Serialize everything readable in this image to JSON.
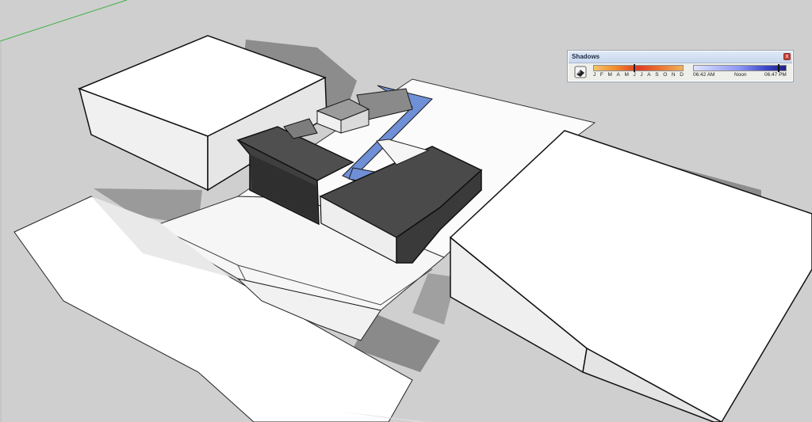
{
  "shadows_panel": {
    "title": "Shadows",
    "close_glyph": "x",
    "toggle_icon": "shadow-toggle-icon",
    "months": [
      "J",
      "F",
      "M",
      "A",
      "M",
      "J",
      "J",
      "A",
      "S",
      "O",
      "N",
      "D"
    ],
    "month_position": 0.45,
    "time_labels": {
      "sunrise": "06:42 AM",
      "noon": "Noon",
      "sunset": "06:47 PM"
    },
    "time_position": 0.93
  },
  "colors": {
    "background": "#cfcfcf",
    "white_face": "#ffffff",
    "light_side": "#ededed",
    "shadow": "#7a7a7a",
    "dark_roof": "#4a4a4a",
    "blue_glass": "#6f8fd6",
    "axis_green": "#3cb043"
  }
}
